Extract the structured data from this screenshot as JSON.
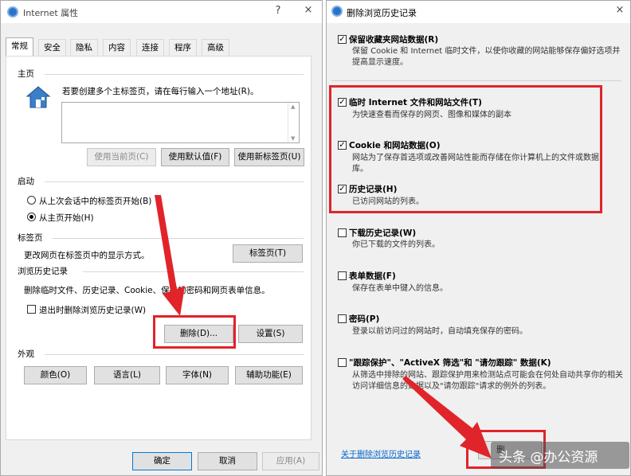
{
  "left_window": {
    "title": "Internet 属性",
    "help": "?",
    "close": "×",
    "tabs": [
      "常规",
      "安全",
      "隐私",
      "内容",
      "连接",
      "程序",
      "高级"
    ],
    "home": {
      "section": "主页",
      "desc": "若要创建多个主标签页，请在每行输入一个地址(R)。",
      "btn_current": "使用当前页(C)",
      "btn_default": "使用默认值(F)",
      "btn_newtab": "使用新标签页(U)"
    },
    "startup": {
      "section": "启动",
      "opt1": "从上次会话中的标签页开始(B)",
      "opt2": "从主页开始(H)"
    },
    "tabsec": {
      "section": "标签页",
      "desc": "更改网页在标签页中的显示方式。",
      "btn": "标签页(T)"
    },
    "history": {
      "section": "浏览历史记录",
      "desc": "删除临时文件、历史记录、Cookie、保存的密码和网页表单信息。",
      "exit_check": "退出时删除浏览历史记录(W)",
      "btn_delete": "删除(D)...",
      "btn_settings": "设置(S)"
    },
    "appearance": {
      "section": "外观",
      "btn_colors": "颜色(O)",
      "btn_lang": "语言(L)",
      "btn_fonts": "字体(N)",
      "btn_access": "辅助功能(E)"
    },
    "footer": {
      "ok": "确定",
      "cancel": "取消",
      "apply": "应用(A)"
    }
  },
  "right_window": {
    "title": "删除浏览历史记录",
    "close": "×",
    "options": [
      {
        "label": "保留收藏夹网站数据(R)",
        "desc": "保留 Cookie 和 Internet 临时文件，以使你收藏的网站能够保存偏好选项并提高显示速度。",
        "checked": true
      },
      {
        "label": "临时 Internet 文件和网站文件(T)",
        "desc": "为快速查看而保存的网页、图像和媒体的副本",
        "checked": true
      },
      {
        "label": "Cookie 和网站数据(O)",
        "desc": "网站为了保存首选项或改善网站性能而存储在你计算机上的文件或数据库。",
        "checked": true
      },
      {
        "label": "历史记录(H)",
        "desc": "已访问网站的列表。",
        "checked": true
      },
      {
        "label": "下载历史记录(W)",
        "desc": "你已下载的文件的列表。",
        "checked": false
      },
      {
        "label": "表单数据(F)",
        "desc": "保存在表单中键入的信息。",
        "checked": false
      },
      {
        "label": "密码(P)",
        "desc": "登录以前访问过的网站时，自动填充保存的密码。",
        "checked": false
      },
      {
        "label": "\"跟踪保护\"、\"ActiveX 筛选\"和 \"请勿跟踪\" 数据(K)",
        "desc": "从筛选中排除的网站、跟踪保护用来检测站点可能会在何处自动共享你的相关访问详细信息的数据以及\"请勿跟踪\"请求的例外的列表。",
        "checked": false
      }
    ],
    "link": "关于删除浏览历史记录",
    "btn_delete": "删",
    "check_glyph": "✓"
  },
  "watermark": "头条 @办公资源",
  "colors": {
    "highlight": "#e0242a",
    "accent": "#0078d7"
  }
}
